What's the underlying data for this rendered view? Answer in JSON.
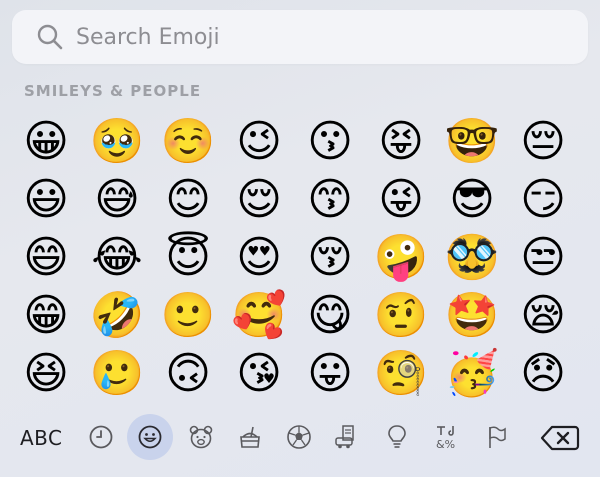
{
  "search": {
    "placeholder": "Search Emoji"
  },
  "section": {
    "title": "SMILEYS & PEOPLE"
  },
  "emoji_rows": [
    [
      "😀",
      "🥹",
      "☺️",
      "😉",
      "😗",
      "😝",
      "🤓",
      "😔"
    ],
    [
      "😃",
      "😅",
      "😊",
      "😌",
      "😙",
      "😜",
      "😎",
      "😏"
    ],
    [
      "😄",
      "😂",
      "😇",
      "😍",
      "😚",
      "🤪",
      "🥸",
      "😒"
    ],
    [
      "😁",
      "🤣",
      "🙂",
      "🥰",
      "😋",
      "🤨",
      "🤩",
      "😪"
    ],
    [
      "😆",
      "🥲",
      "🙃",
      "😘",
      "😛",
      "🧐",
      "🥳",
      "😞"
    ]
  ],
  "keyboard": {
    "abc_label": "ABC",
    "categories": [
      {
        "icon": "clock-icon",
        "glyph": "🕘"
      },
      {
        "icon": "smiley-icon",
        "glyph": "☺",
        "active": true
      },
      {
        "icon": "bear-icon",
        "glyph": "🐻"
      },
      {
        "icon": "food-icon",
        "glyph": "🍔"
      },
      {
        "icon": "soccer-ball-icon",
        "glyph": "⚽"
      },
      {
        "icon": "travel-icon",
        "glyph": "🚗"
      },
      {
        "icon": "lightbulb-icon",
        "glyph": "💡"
      },
      {
        "icon": "symbols-icon",
        "glyph": "†&%"
      },
      {
        "icon": "flag-icon",
        "glyph": "⚐"
      }
    ]
  }
}
